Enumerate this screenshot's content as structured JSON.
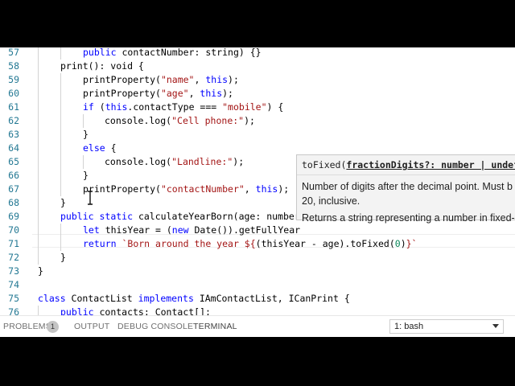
{
  "editor": {
    "lines": [
      {
        "num": "57",
        "indent": 2,
        "tokens": [
          {
            "t": "kw",
            "v": "public"
          },
          {
            "t": "",
            "v": " contactNumber: string) {}"
          }
        ]
      },
      {
        "num": "58",
        "indent": 1,
        "tokens": [
          {
            "t": "",
            "v": "print(): void {"
          }
        ]
      },
      {
        "num": "59",
        "indent": 2,
        "tokens": [
          {
            "t": "",
            "v": "printProperty("
          },
          {
            "t": "str",
            "v": "\"name\""
          },
          {
            "t": "",
            "v": ", "
          },
          {
            "t": "kw",
            "v": "this"
          },
          {
            "t": "",
            "v": ");"
          }
        ]
      },
      {
        "num": "60",
        "indent": 2,
        "tokens": [
          {
            "t": "",
            "v": "printProperty("
          },
          {
            "t": "str",
            "v": "\"age\""
          },
          {
            "t": "",
            "v": ", "
          },
          {
            "t": "kw",
            "v": "this"
          },
          {
            "t": "",
            "v": ");"
          }
        ]
      },
      {
        "num": "61",
        "indent": 2,
        "tokens": [
          {
            "t": "kw",
            "v": "if"
          },
          {
            "t": "",
            "v": " ("
          },
          {
            "t": "kw",
            "v": "this"
          },
          {
            "t": "",
            "v": ".contactType === "
          },
          {
            "t": "str",
            "v": "\"mobile\""
          },
          {
            "t": "",
            "v": ") {"
          }
        ]
      },
      {
        "num": "62",
        "indent": 3,
        "tokens": [
          {
            "t": "",
            "v": "console.log("
          },
          {
            "t": "str",
            "v": "\"Cell phone:\""
          },
          {
            "t": "",
            "v": ");"
          }
        ]
      },
      {
        "num": "63",
        "indent": 2,
        "tokens": [
          {
            "t": "",
            "v": "}"
          }
        ]
      },
      {
        "num": "64",
        "indent": 2,
        "tokens": [
          {
            "t": "kw",
            "v": "else"
          },
          {
            "t": "",
            "v": " {"
          }
        ]
      },
      {
        "num": "65",
        "indent": 3,
        "tokens": [
          {
            "t": "",
            "v": "console.log("
          },
          {
            "t": "str",
            "v": "\"Landline:\""
          },
          {
            "t": "",
            "v": ");"
          }
        ]
      },
      {
        "num": "66",
        "indent": 2,
        "tokens": [
          {
            "t": "",
            "v": "}"
          }
        ]
      },
      {
        "num": "67",
        "indent": 2,
        "tokens": [
          {
            "t": "",
            "v": "printProperty("
          },
          {
            "t": "str",
            "v": "\"contactNumber\""
          },
          {
            "t": "",
            "v": ", "
          },
          {
            "t": "kw",
            "v": "this"
          },
          {
            "t": "",
            "v": ");"
          }
        ]
      },
      {
        "num": "68",
        "indent": 1,
        "tokens": [
          {
            "t": "",
            "v": "}"
          }
        ]
      },
      {
        "num": "69",
        "indent": 1,
        "tokens": [
          {
            "t": "kw",
            "v": "public"
          },
          {
            "t": "",
            "v": " "
          },
          {
            "t": "kw",
            "v": "static"
          },
          {
            "t": "",
            "v": " calculateYearBorn(age: number"
          }
        ]
      },
      {
        "num": "70",
        "indent": 2,
        "tokens": [
          {
            "t": "kw",
            "v": "let"
          },
          {
            "t": "",
            "v": " thisYear = ("
          },
          {
            "t": "kw",
            "v": "new"
          },
          {
            "t": "",
            "v": " Date()).getFullYear"
          }
        ]
      },
      {
        "num": "71",
        "indent": 2,
        "tokens": [
          {
            "t": "kw",
            "v": "return"
          },
          {
            "t": "",
            "v": " "
          },
          {
            "t": "str",
            "v": "`Born around the year ${"
          },
          {
            "t": "",
            "v": "(thisYear - age).toFixed("
          },
          {
            "t": "num",
            "v": "0"
          },
          {
            "t": "",
            "v": ")"
          },
          {
            "t": "str",
            "v": "}`"
          }
        ]
      },
      {
        "num": "72",
        "indent": 1,
        "tokens": [
          {
            "t": "",
            "v": "}"
          }
        ]
      },
      {
        "num": "73",
        "indent": 0,
        "tokens": [
          {
            "t": "",
            "v": "}"
          }
        ]
      },
      {
        "num": "74",
        "indent": 0,
        "tokens": []
      },
      {
        "num": "75",
        "indent": 0,
        "tokens": [
          {
            "t": "kw",
            "v": "class"
          },
          {
            "t": "",
            "v": " ContactList "
          },
          {
            "t": "kw",
            "v": "implements"
          },
          {
            "t": "",
            "v": " IAmContactList, ICanPrint {"
          }
        ]
      },
      {
        "num": "76",
        "indent": 1,
        "tokens": [
          {
            "t": "kw",
            "v": "public"
          },
          {
            "t": "",
            "v": " contacts: Contact[];"
          }
        ]
      }
    ]
  },
  "hover": {
    "sig_prefix": "toFixed(",
    "sig_param": "fractionDigits?: number | undef",
    "desc_line1": "Number of digits after the decimal point. Must b",
    "desc_line2": "20, inclusive.",
    "returns": "Returns a string representing a number in fixed-p"
  },
  "panel": {
    "tabs": [
      "PROBLEMS",
      "OUTPUT",
      "DEBUG CONSOLE",
      "TERMINAL"
    ],
    "problems_count": "1",
    "active_tab": "TERMINAL",
    "terminal_select": "1: bash"
  },
  "colors": {
    "keyword": "#0000ff",
    "string": "#a31515",
    "number": "#098658",
    "line_number": "#237893"
  }
}
